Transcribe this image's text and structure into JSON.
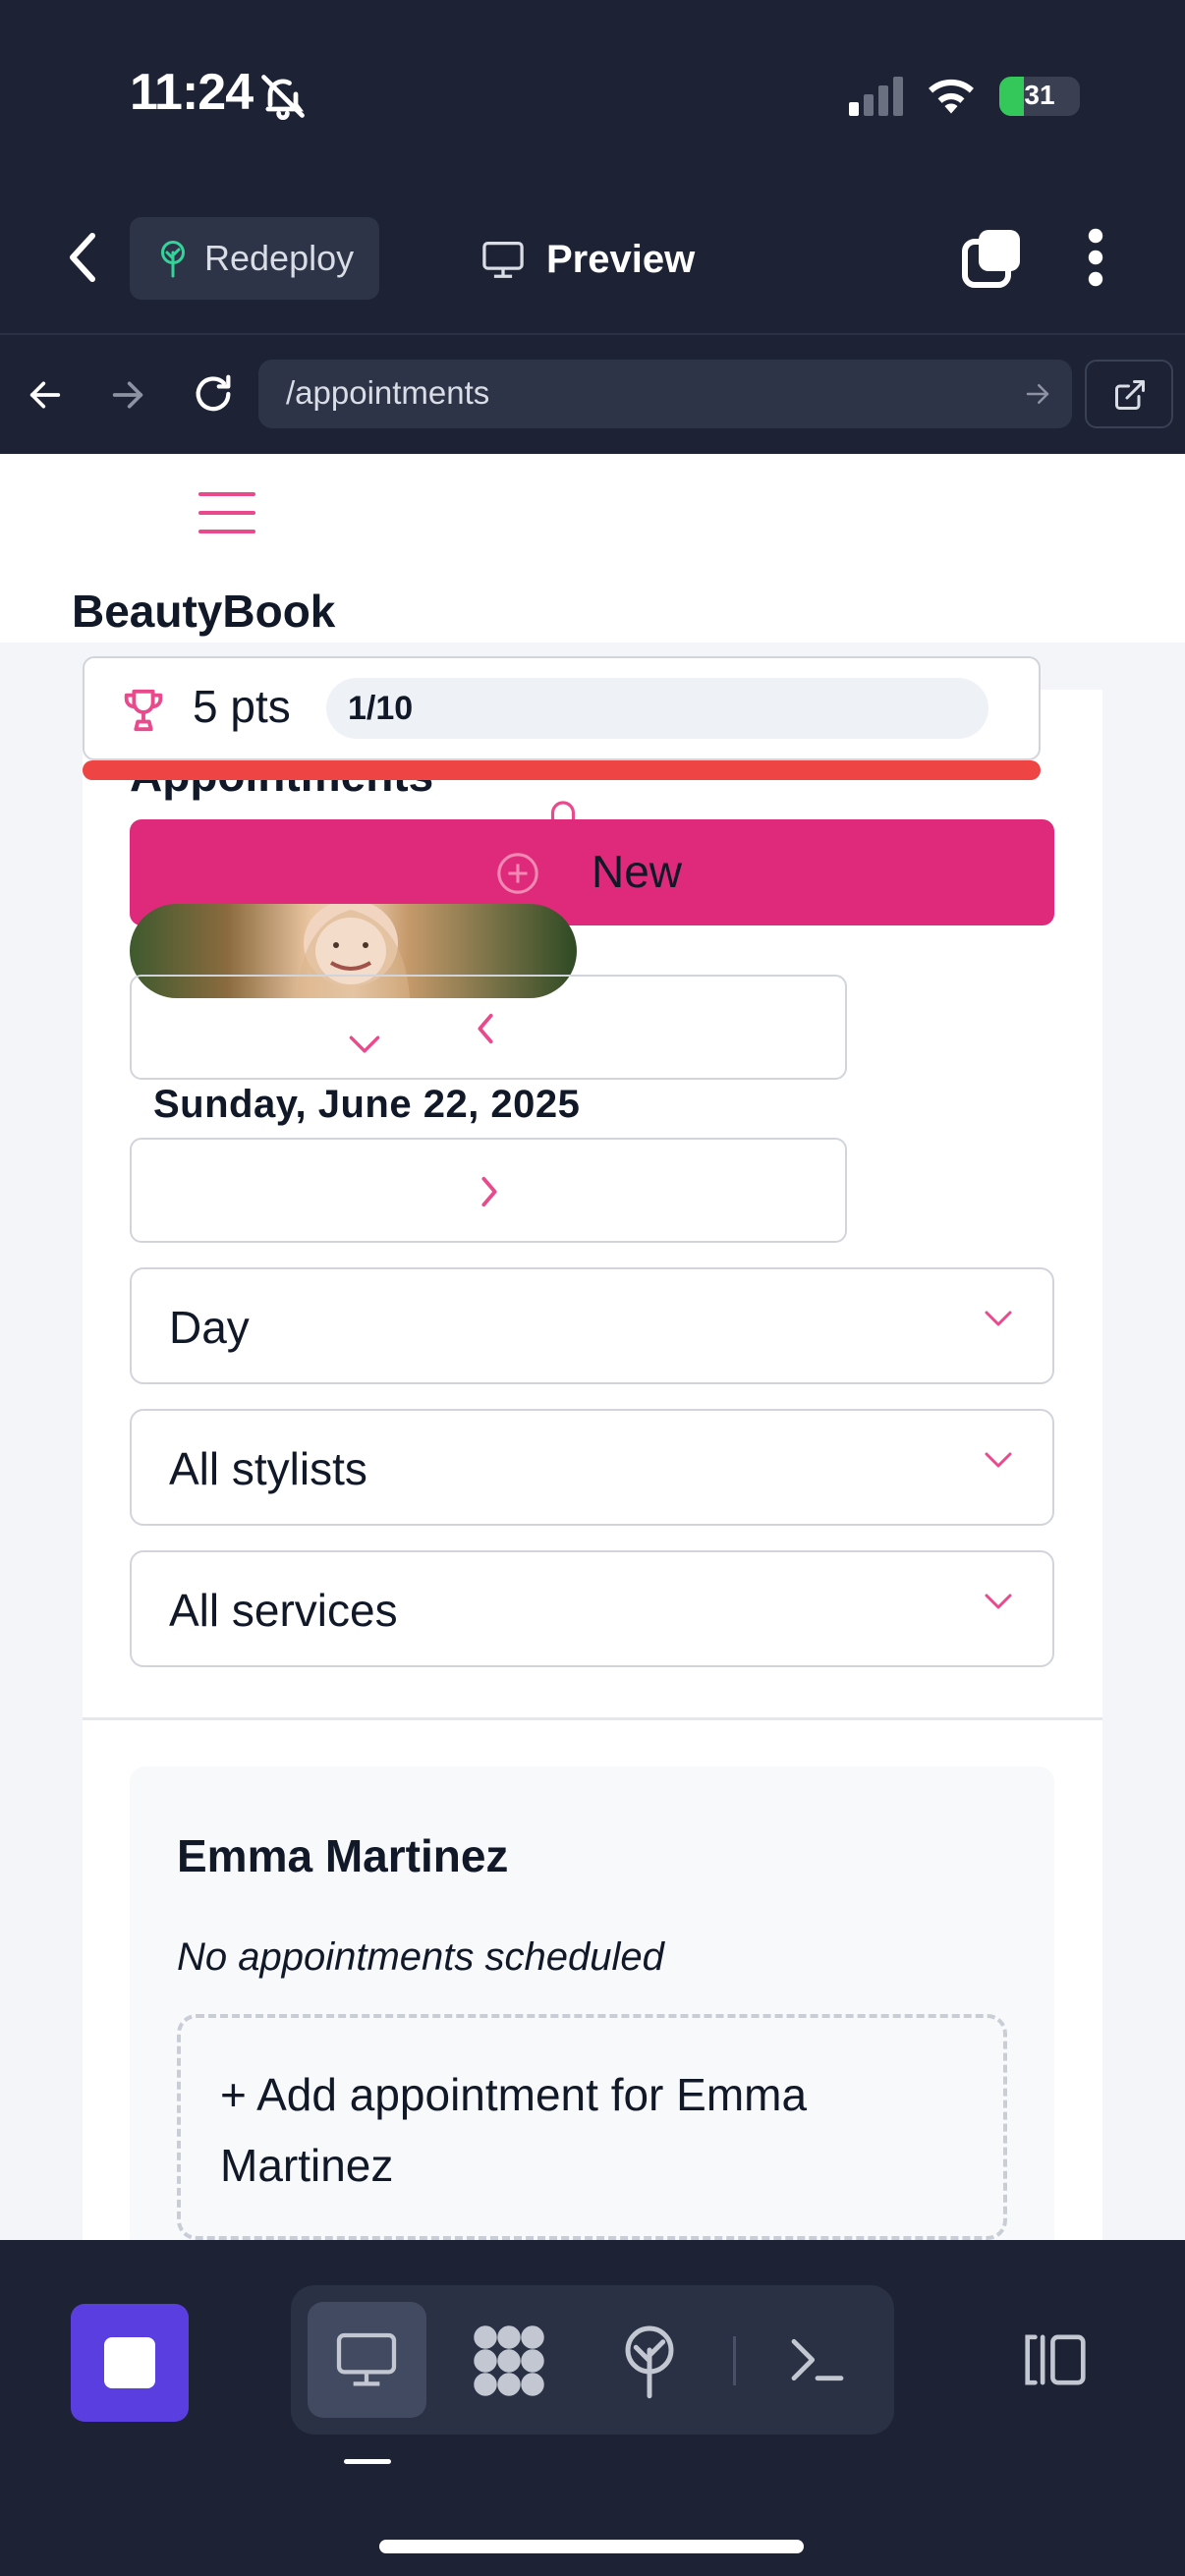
{
  "status_bar": {
    "time": "11:24",
    "battery": "31",
    "battery_level": 0.31
  },
  "toolbar": {
    "redeploy_label": "Redeploy",
    "preview_label": "Preview"
  },
  "browser": {
    "url": "/appointments"
  },
  "app": {
    "brand": "BeautyBook",
    "page_title": "Appointments",
    "points": "5 pts",
    "progress": "1/10",
    "new_button_label": "New",
    "date": "Sunday, June 22, 2025",
    "filters": {
      "view": "Day",
      "stylists": "All stylists",
      "services": "All services"
    },
    "stylist_schedule": {
      "name": "Emma Martinez",
      "empty_message": "No appointments scheduled",
      "add_label": "+ Add appointment for Emma Martinez"
    }
  },
  "colors": {
    "accent": "#df2a7b",
    "accent_icon": "#e84a8c",
    "alert": "#ef4444",
    "dark": "#1d2335"
  },
  "icons": [
    "bell-slash-icon",
    "signal-icon",
    "wifi-icon",
    "battery-icon",
    "back-chevron-icon",
    "tree-icon",
    "monitor-icon",
    "tabs-icon",
    "more-icon",
    "arrow-left-icon",
    "arrow-right-icon",
    "reload-icon",
    "go-arrow-icon",
    "external-link-icon",
    "hamburger-icon",
    "trophy-icon",
    "bell-icon",
    "plus-circle-icon",
    "chevron-left-icon",
    "chevron-right-icon",
    "chevron-down-icon",
    "stop-icon",
    "desktop-icon",
    "apps-icon",
    "deploy-icon",
    "terminal-icon",
    "sidebar-icon"
  ]
}
